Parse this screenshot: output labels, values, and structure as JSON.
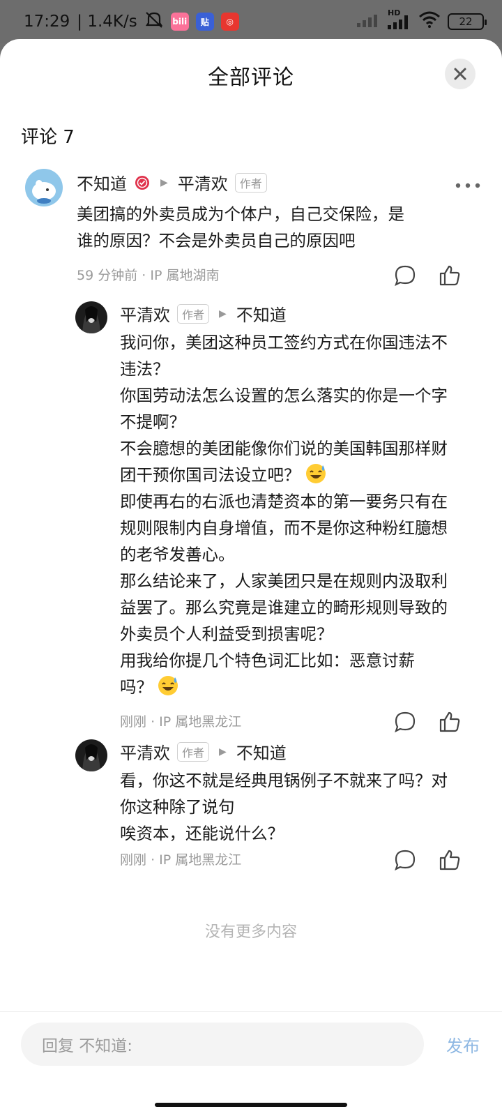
{
  "status_bar": {
    "time": "17:29",
    "speed": "| 1.4K/s",
    "network": "HD",
    "battery": "22",
    "app_icons": [
      "bilibili-icon",
      "tieba-icon",
      "netease-music-icon"
    ]
  },
  "sheet": {
    "title": "全部评论",
    "comment_count": "评论 7"
  },
  "comments": [
    {
      "author": "不知道",
      "reply_to": "平清欢",
      "reply_to_tag": "作者",
      "lines": [
        "美团搞的外卖员成为个体户，自己交保险，是",
        "谁的原因？不会是外卖员自己的原因吧"
      ],
      "time": "59 分钟前",
      "location": "IP 属地湖南"
    },
    {
      "author": "平清欢",
      "author_tag": "作者",
      "reply_to": "不知道",
      "lines": [
        "我问你，美团这种员工签约方式在你国违法不",
        "违法？",
        "你国劳动法怎么设置的怎么落实的你是一个字",
        "不提啊？",
        "不会臆想的美团能像你们说的美国韩国那样财",
        "团干预你国司法设立吧？",
        "即使再右的右派也清楚资本的第一要务只有在",
        "规则限制内自身增值，而不是你这种粉红臆想",
        "的老爷发善心。",
        "那么结论来了，人家美团只是在规则内汲取利",
        "益罢了。那么究竟是谁建立的畸形规则导致的",
        "外卖员个人利益受到损害呢？",
        "用我给你提几个特色词汇比如：恶意讨薪",
        "吗？"
      ],
      "time": "刚刚",
      "location": "IP 属地黑龙江"
    },
    {
      "author": "平清欢",
      "author_tag": "作者",
      "reply_to": "不知道",
      "lines": [
        "看，你这不就是经典甩锅例子不就来了吗？对",
        "你这种除了说句",
        "唉资本，还能说什么？"
      ],
      "time": "刚刚",
      "location": "IP 属地黑龙江"
    }
  ],
  "separator": "·",
  "end_text": "没有更多内容",
  "reply_box": {
    "placeholder": "回复 不知道:",
    "publish": "发布"
  },
  "colors": {
    "accent": "#8fb8e3",
    "meta": "#9a9a9a",
    "badge": "#e0314b"
  }
}
